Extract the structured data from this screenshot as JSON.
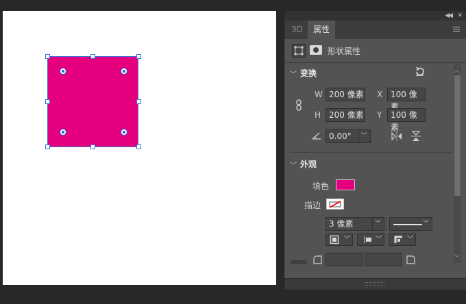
{
  "tabs": [
    {
      "label": "3D"
    },
    {
      "label": "属性"
    }
  ],
  "panel_header": {
    "shape_properties_label": "形状属性"
  },
  "transform": {
    "title": "变换",
    "w_label": "W",
    "w_value": "200 像素",
    "x_label": "X",
    "x_value": "100 像素",
    "h_label": "H",
    "h_value": "200 像素",
    "y_label": "Y",
    "y_value": "100 像素",
    "angle_value": "0.00°"
  },
  "appearance": {
    "title": "外观",
    "fill_label": "填色",
    "fill_color": "#e4007f",
    "stroke_label": "描边",
    "stroke_width": "3 像素"
  },
  "colors": {
    "shape_fill": "#e4007f",
    "selection": "#3a6fd8",
    "panel_bg": "#535353"
  }
}
